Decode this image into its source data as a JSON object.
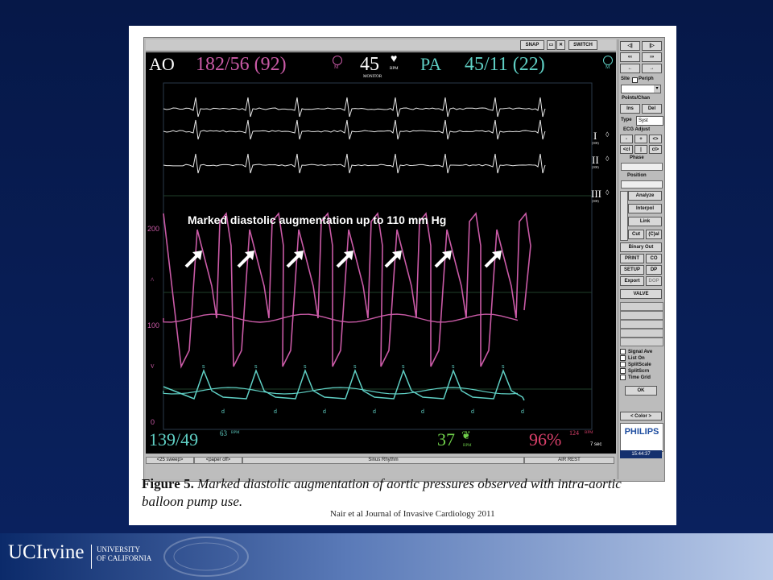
{
  "monitor": {
    "topbar_buttons": [
      "SNAP",
      "SWITCH"
    ],
    "header": {
      "ao_label": "AO",
      "ao_value": "182/56 (92)",
      "ao_marker": "M",
      "hr_value": "45",
      "hr_unit": "BPM",
      "hr_sub": "MONITOR",
      "pa_label": "PA",
      "pa_value": "45/11 (22)",
      "pa_marker": "M"
    },
    "ecg_leads": [
      {
        "name": "I",
        "scale": "(100)"
      },
      {
        "name": "II",
        "scale": "(100)"
      },
      {
        "name": "III",
        "scale": "(100)"
      }
    ],
    "annotation": "Marked diastolic augmentation up to 110 mm Hg",
    "y_scale": [
      "200",
      "100",
      "0"
    ],
    "wave_marks": {
      "s": "s",
      "d": "d"
    },
    "bottom": {
      "left_value": "139/49",
      "left_rate": "63",
      "left_unit": "BPM",
      "resp_value": "37",
      "resp_unit": "RPM",
      "spo2_value": "96%",
      "spo2_rate": "124",
      "spo2_unit": "BPM",
      "time_scale": "7 sec"
    },
    "status": {
      "sweep": "<25 sweep>",
      "paper": "<paper off>",
      "rhythm": "Sinus Rhythm",
      "mode": "AIR REST"
    },
    "side": {
      "site_label": "Site",
      "periph_label": "Periph",
      "points_chan": "Points/Chan",
      "ins": "Ins",
      "del": "Del",
      "type_label": "Type",
      "type_value": "Syst",
      "ecg_adjust": "ECG Adjust",
      "phase": "Phase",
      "position": "Position",
      "analyze": "Analyze",
      "interpol": "Interpol",
      "link": "Link",
      "cut": "Cut",
      "cal": "(C)al",
      "binary_out": "Binary Out",
      "print": "PRINT",
      "co": "CO",
      "setup": "SETUP",
      "dp": "DP",
      "export": "Export",
      "dop": "DOP",
      "valve": "VALVE",
      "checks": [
        "Signal Ave",
        "List On",
        "SplitScale",
        "SplitScrn",
        "Time Grid"
      ],
      "ok": "OK",
      "color": "< Color >",
      "brand": "PHILIPS",
      "clock": "15:44:37"
    }
  },
  "caption": {
    "label": "Figure 5.",
    "text": "Marked diastolic augmentation of aortic pressures observed with intra-aortic balloon pump use."
  },
  "citation": "Nair et al Journal of  Invasive Cardiology 2011",
  "footer": {
    "logo": "UCIrvine",
    "sub1": "UNIVERSITY",
    "sub2": "OF CALIFORNIA"
  },
  "colors": {
    "aortic": "#c95aa6",
    "pa": "#5fcfc4",
    "ecg": "#e8e8e8",
    "resp": "#6fcf4a",
    "spo2": "#d9406a"
  }
}
